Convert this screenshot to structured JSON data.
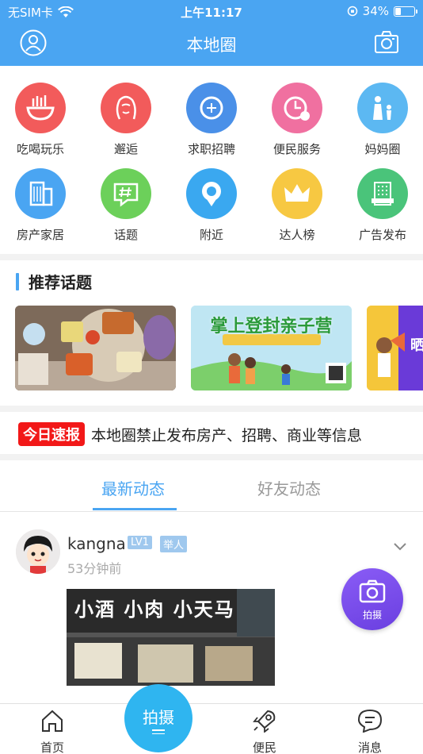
{
  "status_bar": {
    "carrier": "无SIM卡",
    "time": "上午11:17",
    "battery": "34%",
    "battery_level": 0.34
  },
  "header": {
    "title": "本地圈"
  },
  "categories": [
    {
      "label": "吃喝玩乐",
      "icon": "noodle-bowl-icon",
      "color": "#f25b5b"
    },
    {
      "label": "邂逅",
      "icon": "woman-face-icon",
      "color": "#f25b5b"
    },
    {
      "label": "求职招聘",
      "icon": "recruit-icon",
      "color": "#4a90e8"
    },
    {
      "label": "便民服务",
      "icon": "clock-money-icon",
      "color": "#f070a0"
    },
    {
      "label": "妈妈圈",
      "icon": "mother-child-icon",
      "color": "#5cb8f2"
    },
    {
      "label": "房产家居",
      "icon": "building-icon",
      "color": "#4aa5f2"
    },
    {
      "label": "话题",
      "icon": "hashtag-icon",
      "color": "#6cd05a"
    },
    {
      "label": "附近",
      "icon": "location-icon",
      "color": "#3aa8f0"
    },
    {
      "label": "达人榜",
      "icon": "crown-icon",
      "color": "#f7c842"
    },
    {
      "label": "广告发布",
      "icon": "hotel-icon",
      "color": "#4ac47a"
    }
  ],
  "recommend": {
    "title": "推荐话题",
    "cards": [
      {
        "name": "food-photo"
      },
      {
        "name": "family-camp",
        "title": "掌上登封亲子营"
      },
      {
        "name": "promo-partial",
        "title": "晒"
      }
    ]
  },
  "news": {
    "tag": "今日速报",
    "text": "本地圈禁止发布房产、招聘、商业等信息"
  },
  "tabs": [
    {
      "label": "最新动态",
      "active": true
    },
    {
      "label": "好友动态",
      "active": false
    }
  ],
  "post": {
    "username": "kangna",
    "level": "LV1",
    "role": "举人",
    "time": "53分钟前",
    "photo_sign": "小酒 小肉 小天马"
  },
  "fab": {
    "label": "拍摄"
  },
  "bottom_nav": {
    "home": "首页",
    "shoot": "拍摄",
    "service": "便民",
    "messages": "消息"
  }
}
